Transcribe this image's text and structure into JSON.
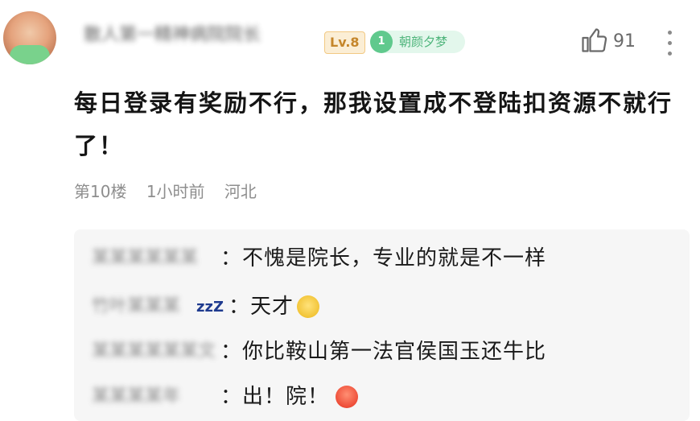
{
  "post": {
    "username": "散人第一精神病院院长",
    "level": "Lv.8",
    "medal_level": "1",
    "medal_name": "朝颜夕梦",
    "like_count": "91",
    "comment_lines": [
      "每日登录有奖励不行，那我设置成不登陆扣资源不就行",
      "了！"
    ],
    "floor": "第10楼",
    "time": "1小时前",
    "location": "河北"
  },
  "replies": [
    {
      "name": "某某某某某某",
      "text": "：不愧是院长，专业的就是不一样"
    },
    {
      "name": "竹叶某某某",
      "suffix": "zzZ",
      "text": "：天才"
    },
    {
      "name": "某某某某某某文",
      "text": "：你比鞍山第一法官侯国玉还牛比"
    },
    {
      "name": "某某某某年",
      "text": "：出！院！"
    }
  ],
  "colors": {
    "level_badge": "#c5862b",
    "medal_green": "#60c98d",
    "meta_gray": "#8e8e8e",
    "reply_bg": "#f6f6f6"
  },
  "icons": [
    "thumb-up-icon",
    "more-vertical-icon",
    "angry-emoji-icon",
    "mad-emoji-icon"
  ]
}
